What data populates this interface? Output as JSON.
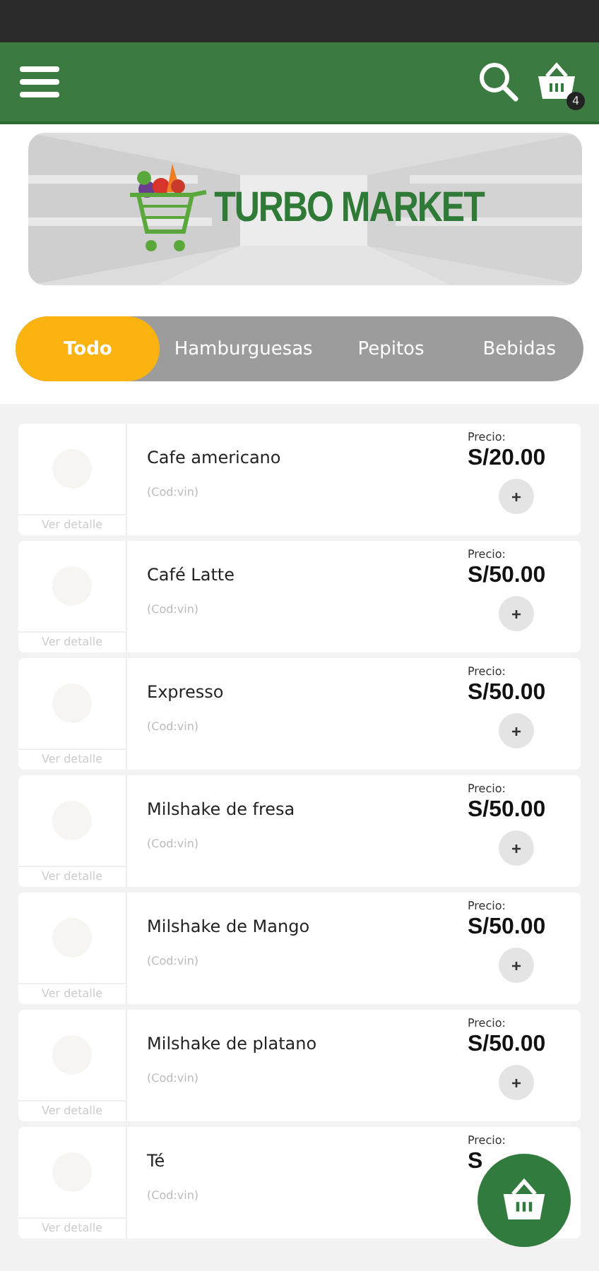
{
  "header": {
    "cart_count": "4"
  },
  "banner": {
    "title": "TURBO MARKET"
  },
  "tabs": [
    {
      "label": "Todo",
      "selected": true
    },
    {
      "label": "Hamburguesas",
      "selected": false
    },
    {
      "label": "Pepitos",
      "selected": false
    },
    {
      "label": "Bebidas",
      "selected": false
    }
  ],
  "products": [
    {
      "name": "Cafe americano",
      "code": "(Cod:vin)",
      "details": "Ver detalle",
      "price_label": "Precio:",
      "price": "S/20.00",
      "add_button": "+"
    },
    {
      "name": "Café Latte",
      "code": "(Cod:vin)",
      "details": "Ver detalle",
      "price_label": "Precio:",
      "price": "S/50.00",
      "add_button": "+"
    },
    {
      "name": "Expresso",
      "code": "(Cod:vin)",
      "details": "Ver detalle",
      "price_label": "Precio:",
      "price": "S/50.00",
      "add_button": "+"
    },
    {
      "name": "Milshake de fresa",
      "code": "(Cod:vin)",
      "details": "Ver detalle",
      "price_label": "Precio:",
      "price": "S/50.00",
      "add_button": "+"
    },
    {
      "name": "Milshake de Mango",
      "code": "(Cod:vin)",
      "details": "Ver detalle",
      "price_label": "Precio:",
      "price": "S/50.00",
      "add_button": "+"
    },
    {
      "name": "Milshake de platano",
      "code": "(Cod:vin)",
      "details": "Ver detalle",
      "price_label": "Precio:",
      "price": "S/50.00",
      "add_button": "+"
    },
    {
      "name": "Té",
      "code": "(Cod:vin)",
      "details": "Ver detalle",
      "price_label": "Precio:",
      "price": "S"
    }
  ]
}
